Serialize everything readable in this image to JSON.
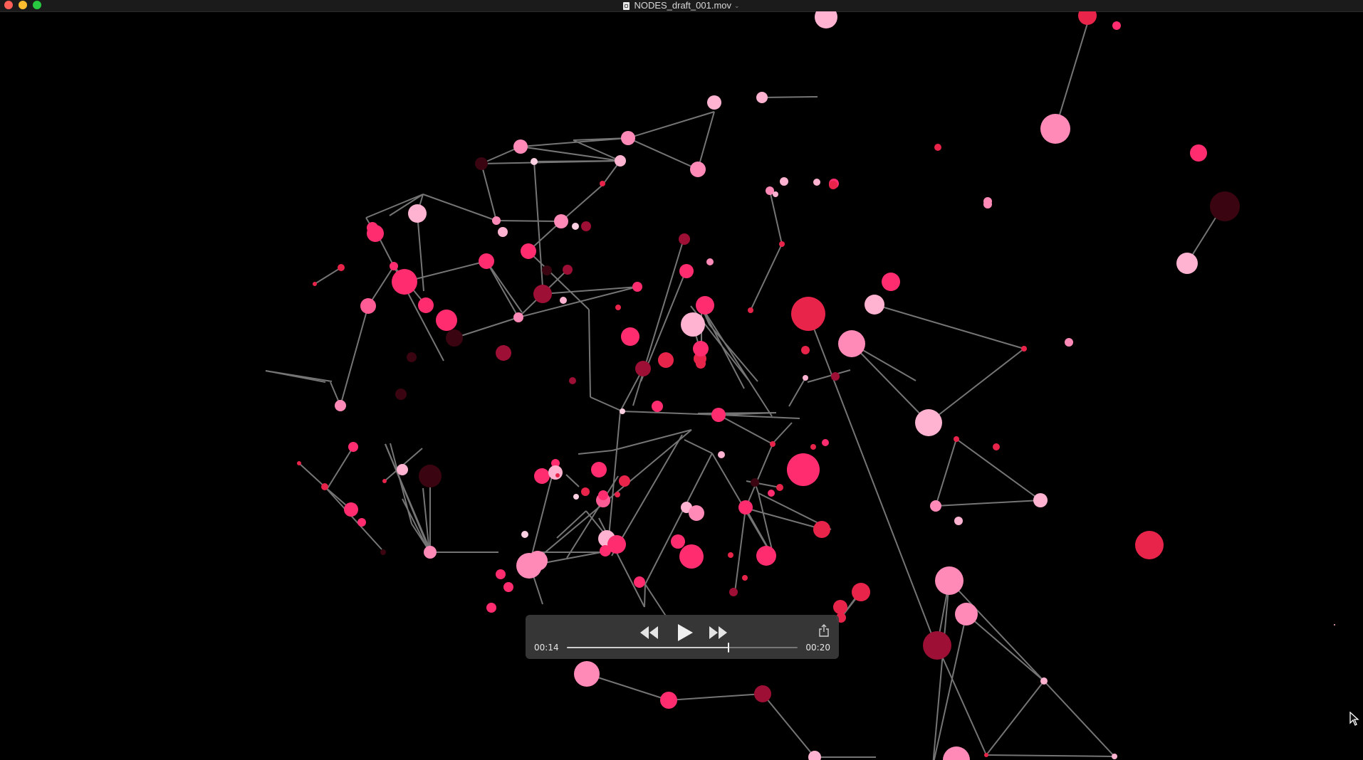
{
  "window": {
    "title": "NODES_draft_001.mov",
    "title_chevron": "⌄"
  },
  "player": {
    "current_time": "00:14",
    "total_time": "00:20",
    "progress": 0.7
  },
  "colors": {
    "background": "#000000",
    "edge": "#8a8a8a",
    "controls_bg": "#3a3a3a",
    "node_palette": [
      "#ff2d6f",
      "#e8244a",
      "#ff5c96",
      "#ffb3d1",
      "#ff8ab8",
      "#9e0f35",
      "#6b0a1f",
      "#3a0510"
    ]
  },
  "icons": {
    "rewind": "rewind-icon",
    "play": "play-icon",
    "fastforward": "fastforward-icon",
    "share": "share-icon",
    "document": "document-icon",
    "cursor": "mouse-pointer-icon"
  }
}
